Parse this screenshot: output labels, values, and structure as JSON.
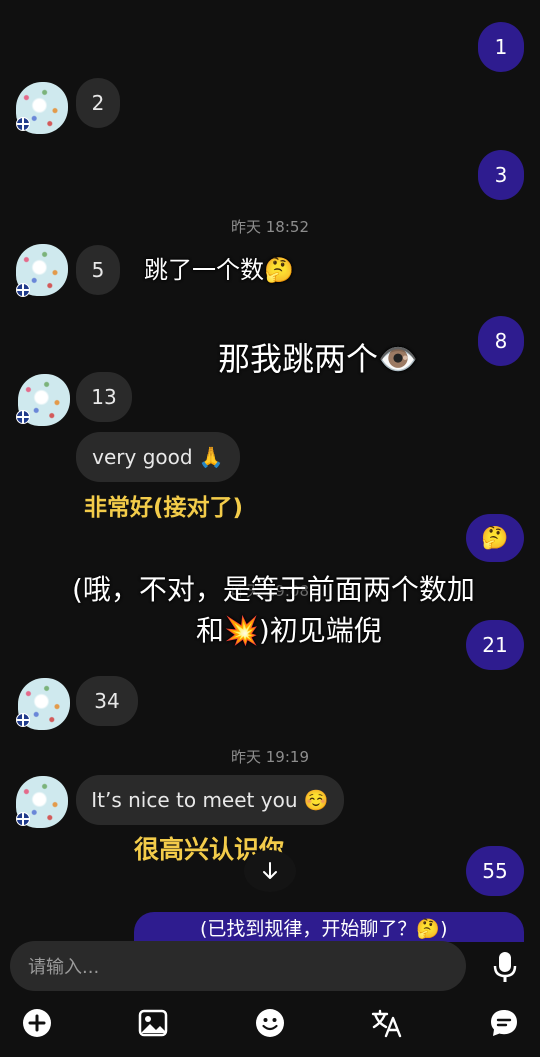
{
  "messages": {
    "out_1": "1",
    "in_2": "2",
    "out_3": "3",
    "time_1": "昨天 18:52",
    "in_5": "5",
    "overlay_jump_one": "跳了一个数🤔",
    "overlay_jump_two": "那我跳两个👁️",
    "out_8": "8",
    "in_13": "13",
    "in_very_good": "very good 🙏",
    "overlay_very_good_cn": "非常好(接对了)",
    "out_thinking": "🤔",
    "time_2": "昨天 19:08",
    "overlay_oh_line1": "(哦，不对，是等于前面两个数加",
    "overlay_oh_line2": "和💥)初见端倪",
    "out_21": "21",
    "in_34": "34",
    "time_3": "昨天 19:19",
    "in_nice": "It’s nice to meet you ☺️",
    "overlay_nice_cn": "很高兴认识你",
    "out_55": "55",
    "overlay_found_pattern": "(已找到规律，开始聊了？🤔)"
  },
  "composer": {
    "placeholder": "请输入..."
  },
  "toolbar": {
    "icons": [
      "plus-icon",
      "image-icon",
      "emoji-icon",
      "translate-icon",
      "chat-icon"
    ]
  },
  "colors": {
    "outgoing_bubble": "#2e1c8f",
    "incoming_bubble": "#2a2a2a",
    "background": "#101010",
    "overlay_yellow": "#f3cc4a"
  }
}
